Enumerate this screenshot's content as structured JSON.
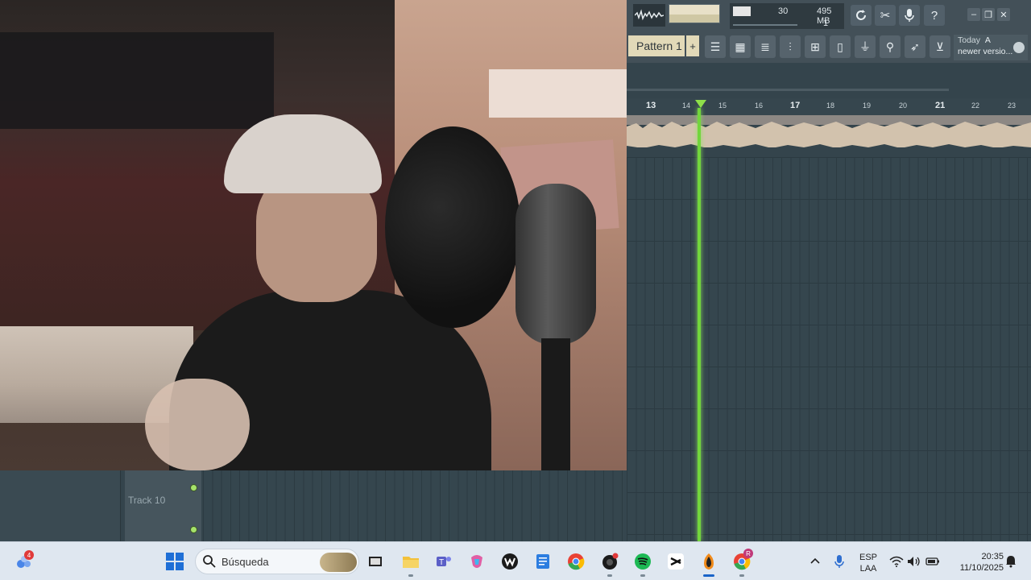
{
  "topbar": {
    "cpu_value": "30",
    "memory": "495 MB",
    "poly": "1",
    "news_title": "Today",
    "news_flag": "A",
    "news_text": "newer versio..."
  },
  "pattern": {
    "label": "Pattern 1",
    "add": "+"
  },
  "playlist": {
    "ruler_ticks": [
      "13",
      "14",
      "15",
      "16",
      "17",
      "18",
      "19",
      "20",
      "21",
      "22",
      "23"
    ],
    "track_label": "Track 10"
  },
  "taskbar": {
    "start_badge": "4",
    "search_placeholder": "Búsqueda",
    "recorder_badge": "R",
    "language_top": "ESP",
    "language_bottom": "LAA",
    "time": "20:35",
    "date": "11/10/2025"
  },
  "colors": {
    "accent_green": "#72d63c",
    "panel": "#435058",
    "playlist_bg": "#34444c",
    "taskbar": "#dfe7f0"
  },
  "icons": {
    "toolbar": [
      "refresh-icon",
      "cut-icon",
      "mic-icon",
      "help-icon",
      "minimize-icon",
      "restore-icon",
      "close-icon"
    ],
    "tools": [
      "playlist-icon",
      "piano-roll-icon",
      "channel-rack-icon",
      "mixer-icon",
      "browser-icon",
      "file-icon",
      "plugin-icon",
      "person-icon",
      "wing-icon",
      "cart-icon"
    ]
  }
}
